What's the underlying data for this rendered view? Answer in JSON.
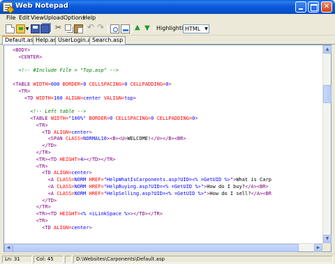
{
  "window": {
    "title": "Web Notepad"
  },
  "menu": {
    "items": [
      "File",
      "Edit",
      "View",
      "Upload",
      "Options",
      "Help"
    ]
  },
  "toolbar": {
    "icons": [
      "new-file",
      "open-folder",
      "open-dropdown",
      "save",
      "save-all",
      "cut",
      "copy",
      "paste",
      "undo",
      "redo",
      "find",
      "replace",
      "move-up",
      "move-down"
    ],
    "highlighting_label": "Highlighting:",
    "highlighting_value": "HTML"
  },
  "tabs": [
    {
      "label": "Default.asp",
      "active": true
    },
    {
      "label": "Help.asp",
      "active": false
    },
    {
      "label": "UserLogin.asp",
      "active": false
    },
    {
      "label": "Search.asp",
      "active": false
    }
  ],
  "editor": {
    "lines": [
      [
        [
          "tag",
          "<BODY>"
        ]
      ],
      [
        [
          "txt",
          "  "
        ],
        [
          "tag",
          "<CENTER>"
        ]
      ],
      [],
      [
        [
          "txt",
          "  "
        ],
        [
          "cmt",
          "<!-- #Include File = \"Top.asp\" -->"
        ]
      ],
      [],
      [
        [
          "tag",
          "<TABLE "
        ],
        [
          "attr",
          "WIDTH="
        ],
        [
          "val",
          "600 "
        ],
        [
          "attr",
          "BORDER="
        ],
        [
          "val",
          "0 "
        ],
        [
          "attr",
          "CELLSPACING="
        ],
        [
          "val",
          "0 "
        ],
        [
          "attr",
          "CELLPADDING="
        ],
        [
          "val",
          "0"
        ],
        [
          "tag",
          ">"
        ]
      ],
      [
        [
          "txt",
          "  "
        ],
        [
          "tag",
          "<TR>"
        ]
      ],
      [
        [
          "txt",
          "    "
        ],
        [
          "tag",
          "<TD "
        ],
        [
          "attr",
          "WIDTH="
        ],
        [
          "val",
          "160 "
        ],
        [
          "attr",
          "ALIGN="
        ],
        [
          "val",
          "center "
        ],
        [
          "attr",
          "VALIGN="
        ],
        [
          "val",
          "top"
        ],
        [
          "tag",
          ">"
        ]
      ],
      [],
      [
        [
          "txt",
          "      "
        ],
        [
          "cmt",
          "<!-- Left table -->"
        ]
      ],
      [
        [
          "txt",
          "      "
        ],
        [
          "tag",
          "<TABLE "
        ],
        [
          "attr",
          "WIDTH="
        ],
        [
          "val",
          "\"100%\" "
        ],
        [
          "attr",
          "BORDER="
        ],
        [
          "val",
          "0 "
        ],
        [
          "attr",
          "CELLSPACING="
        ],
        [
          "val",
          "0 "
        ],
        [
          "attr",
          "CELLPADDING="
        ],
        [
          "val",
          "0"
        ],
        [
          "tag",
          ">"
        ]
      ],
      [
        [
          "txt",
          "        "
        ],
        [
          "tag",
          "<TR>"
        ]
      ],
      [
        [
          "txt",
          "          "
        ],
        [
          "tag",
          "<TD "
        ],
        [
          "attr",
          "ALIGN="
        ],
        [
          "val",
          "center"
        ],
        [
          "tag",
          ">"
        ]
      ],
      [
        [
          "txt",
          "            "
        ],
        [
          "tag",
          "<SPAN "
        ],
        [
          "attr",
          "CLASS="
        ],
        [
          "val",
          "NORMAL10"
        ],
        [
          "tag",
          "><B><U>"
        ],
        [
          "txt",
          "WELCOME!"
        ],
        [
          "tag",
          "</U></B><BR>"
        ]
      ],
      [
        [
          "txt",
          "          "
        ],
        [
          "tag",
          "</TD>"
        ]
      ],
      [
        [
          "txt",
          "        "
        ],
        [
          "tag",
          "</TR>"
        ]
      ],
      [
        [
          "txt",
          "        "
        ],
        [
          "tag",
          "<TR><TD "
        ],
        [
          "attr",
          "HEIGHT="
        ],
        [
          "val",
          "4"
        ],
        [
          "tag",
          "></TD></TR>"
        ]
      ],
      [
        [
          "txt",
          "        "
        ],
        [
          "tag",
          "<TR>"
        ]
      ],
      [
        [
          "txt",
          "          "
        ],
        [
          "tag",
          "<TD "
        ],
        [
          "attr",
          "ALIGN="
        ],
        [
          "val",
          "center"
        ],
        [
          "tag",
          ">"
        ]
      ],
      [
        [
          "txt",
          "            "
        ],
        [
          "tag",
          "<A "
        ],
        [
          "attr",
          "CLASS="
        ],
        [
          "val",
          "NORM "
        ],
        [
          "attr",
          "HREF="
        ],
        [
          "val",
          "\"HelpWhatIsCarponents.asp?UID=<% =GetUID %>\""
        ],
        [
          "tag",
          ">"
        ],
        [
          "txt",
          "What is Carp"
        ]
      ],
      [
        [
          "txt",
          "            "
        ],
        [
          "tag",
          "<A "
        ],
        [
          "attr",
          "CLASS="
        ],
        [
          "val",
          "NORM "
        ],
        [
          "attr",
          "HREF="
        ],
        [
          "val",
          "\"HelpBuying.asp?UID=<% =GetUID %>\""
        ],
        [
          "tag",
          ">"
        ],
        [
          "txt",
          "How do I buy?"
        ],
        [
          "tag",
          "</A><BR>"
        ]
      ],
      [
        [
          "txt",
          "            "
        ],
        [
          "tag",
          "<A "
        ],
        [
          "attr",
          "CLASS="
        ],
        [
          "val",
          "NORM "
        ],
        [
          "attr",
          "HREF="
        ],
        [
          "val",
          "\"HelpSelling.asp?UID=<% =GetUID %>\""
        ],
        [
          "tag",
          ">"
        ],
        [
          "txt",
          "How do I sell?"
        ],
        [
          "tag",
          "</A><BR"
        ]
      ],
      [
        [
          "txt",
          "          "
        ],
        [
          "tag",
          "</TD>"
        ]
      ],
      [
        [
          "txt",
          "        "
        ],
        [
          "tag",
          "</TR>"
        ]
      ],
      [
        [
          "txt",
          "        "
        ],
        [
          "tag",
          "<TR><TD "
        ],
        [
          "attr",
          "HEIGHT="
        ],
        [
          "val",
          "<% =iLinkSpace %>"
        ],
        [
          "tag",
          "></TD></TR>"
        ]
      ],
      [
        [
          "txt",
          "        "
        ],
        [
          "tag",
          "<TR>"
        ]
      ],
      [
        [
          "txt",
          "          "
        ],
        [
          "tag",
          "<TD "
        ],
        [
          "attr",
          "ALIGN="
        ],
        [
          "val",
          "center"
        ],
        [
          "tag",
          ">"
        ]
      ]
    ]
  },
  "status": {
    "line": "Ln: 31",
    "col": "Col: 45",
    "path": "D:\\Websites\\Carponents\\Default.asp"
  }
}
